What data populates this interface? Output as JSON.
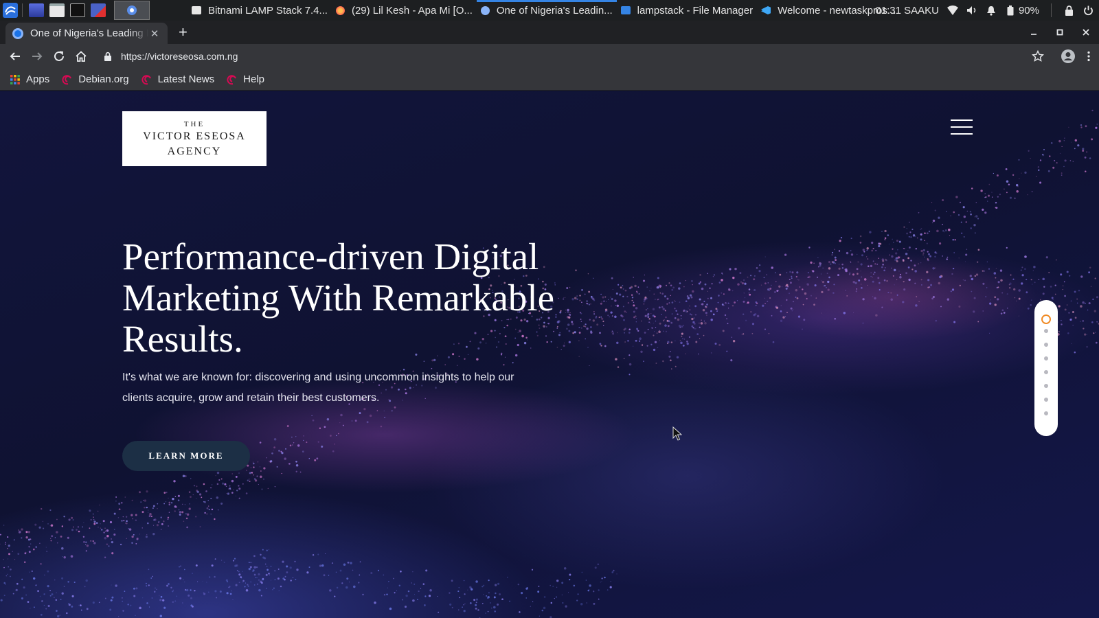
{
  "taskbar": {
    "tasks": [
      {
        "label": "Bitnami LAMP Stack 7.4...",
        "icon": "document-icon",
        "color": "#e6e6e6"
      },
      {
        "label": "(29) Lil Kesh - Apa Mi [O...",
        "icon": "firefox-icon",
        "color": "#ff7139"
      },
      {
        "label": "One of Nigeria's Leadin...",
        "icon": "chromium-icon",
        "color": "#8ab4f8"
      },
      {
        "label": "lampstack - File Manager",
        "icon": "folder-icon",
        "color": "#3584e4"
      },
      {
        "label": "Welcome - newtaskpros...",
        "icon": "vscode-icon",
        "color": "#3ea7f5"
      }
    ],
    "clock": "01:31 SAAKU",
    "battery": "90%"
  },
  "browser": {
    "tab_title": "One of Nigeria's Leading Digital",
    "tab_close": "✕",
    "new_tab": "+",
    "url": "https://victoreseosa.com.ng",
    "bookmarks": [
      "Apps",
      "Debian.org",
      "Latest News",
      "Help"
    ]
  },
  "site": {
    "logo": {
      "line1": "THE",
      "line2": "VICTOR ESEOSA",
      "line3": "AGENCY"
    },
    "headline": "Performance-driven Digital Marketing With Remarkable Results.",
    "subtext": "It's what we are known for: discovering and using uncommon insights to help our clients acquire, grow and retain their best customers.",
    "cta_label": "LEARN MORE",
    "slide_count": 8,
    "active_slide": 1,
    "accent_color": "#f08a24"
  }
}
